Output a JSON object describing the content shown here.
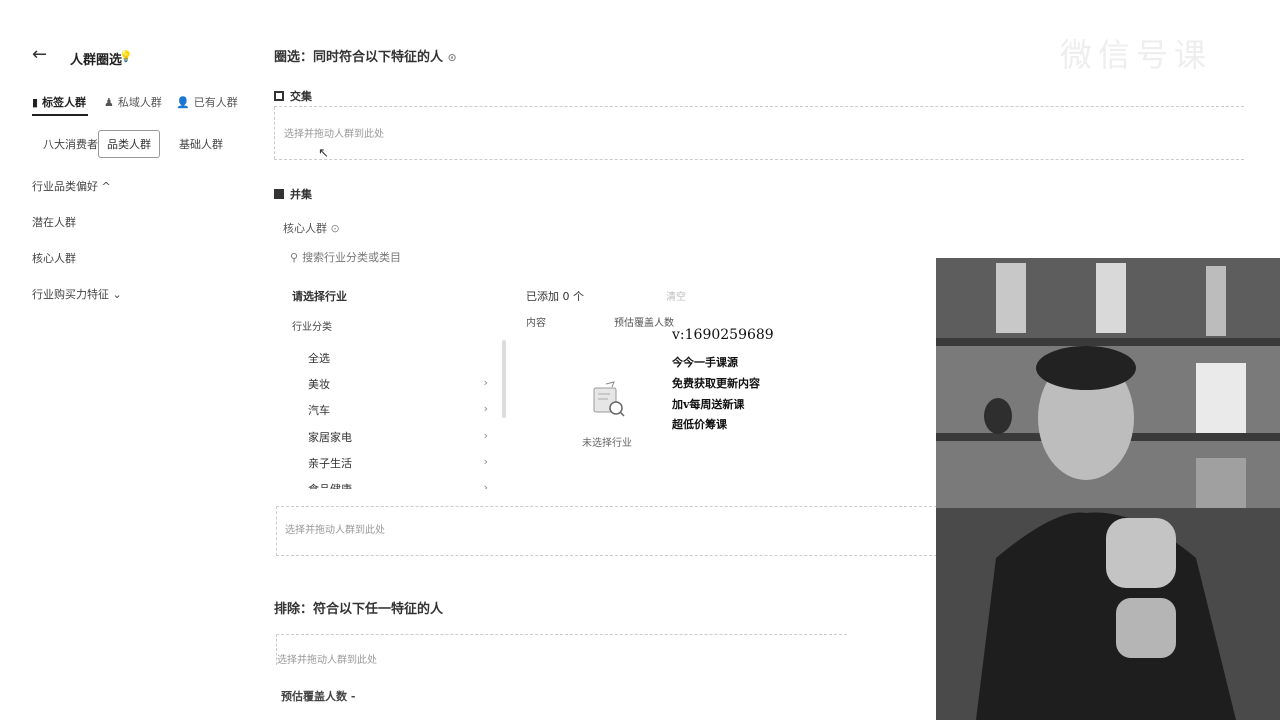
{
  "panel": {
    "title": "人群圈选",
    "tabs": [
      {
        "label": "标签人群",
        "icon": "tag-icon"
      },
      {
        "label": "私域人群",
        "icon": "users-icon"
      },
      {
        "label": "已有人群",
        "icon": "person-icon"
      }
    ],
    "subtabs": [
      "八大消费者",
      "品类人群",
      "基础人群"
    ],
    "menu": [
      "行业品类偏好 ^",
      "潜在人群",
      "核心人群",
      "行业购买力特征 ⌄"
    ]
  },
  "main": {
    "section_title": "圈选：同时符合以下特征的人",
    "intersection_label": "交集",
    "intersection_hint": "选择并拖动人群到此处",
    "union_label": "并集",
    "core_label": "核心人群",
    "search_placeholder": "搜索行业分类或类目",
    "industry_heading": "请选择行业",
    "industry_sub": "行业分类",
    "industry_items": [
      "全选",
      "美妆",
      "汽车",
      "家居家电",
      "亲子生活",
      "食品健康"
    ],
    "added_label": "已添加 0 个",
    "clear_label": "清空",
    "col_content": "内容",
    "col_estimate": "预估覆盖人数",
    "empty_text": "未选择行业",
    "union_hint": "选择并拖动人群到此处",
    "exclude_title": "排除：符合以下任一特征的人",
    "exclude_hint": "选择并拖动人群到此处",
    "estimate_label": "预估覆盖人数",
    "estimate_value": "-"
  },
  "overlay": {
    "contact": "v:1690259689",
    "lines": [
      "今今一手课源",
      "免费获取更新内容",
      "加v每周送新课",
      "超低价筹课"
    ]
  },
  "watermark": "微信号课"
}
